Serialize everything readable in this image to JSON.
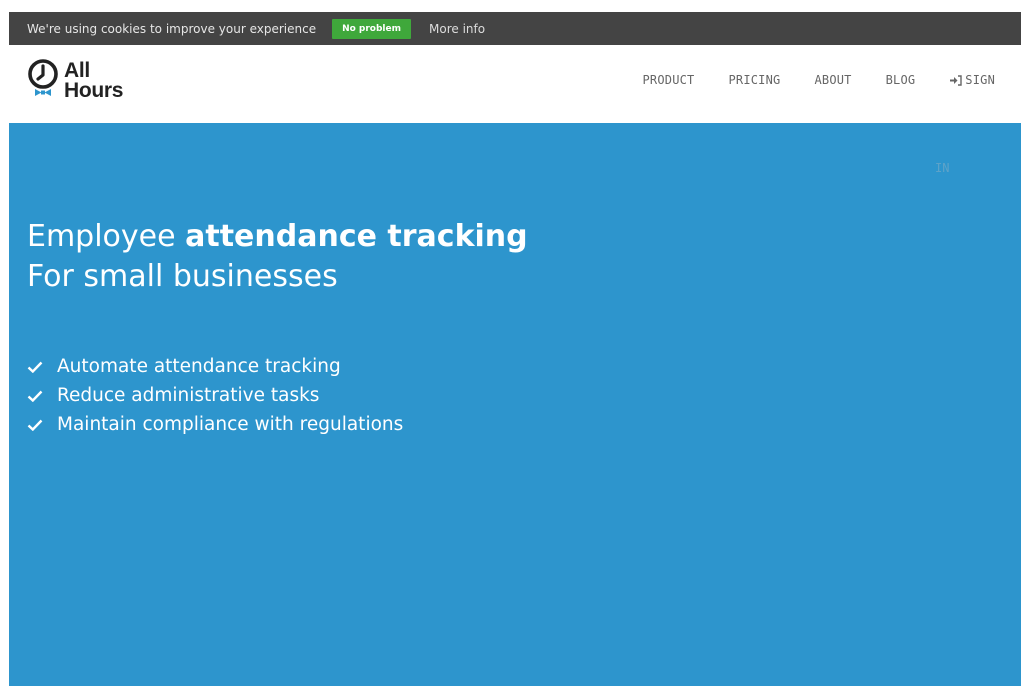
{
  "cookie_bar": {
    "message": "We're using cookies to improve your experience",
    "accept_label": "No problem",
    "more_label": "More info"
  },
  "header": {
    "logo": {
      "line1": "All",
      "line2": "Hours"
    },
    "nav": [
      {
        "label": "PRODUCT"
      },
      {
        "label": "PRICING"
      },
      {
        "label": "ABOUT"
      },
      {
        "label": "BLOG"
      }
    ],
    "signin_label": "SIGN",
    "signin_label_overflow": "IN"
  },
  "hero": {
    "title_plain": "Employee ",
    "title_bold": "attendance tracking",
    "subtitle": "For small businesses",
    "features": [
      "Automate attendance tracking",
      "Reduce administrative tasks",
      "Maintain compliance with regulations"
    ]
  },
  "colors": {
    "cookie_bar_bg": "#444444",
    "accept_button": "#3fa83b",
    "hero_bg": "#2d95cd",
    "logo_accent": "#2d95cd"
  },
  "icons": {
    "logo": "clock-with-bowtie-icon",
    "signin": "sign-in-arrow-icon",
    "feature": "checkmark-icon"
  }
}
